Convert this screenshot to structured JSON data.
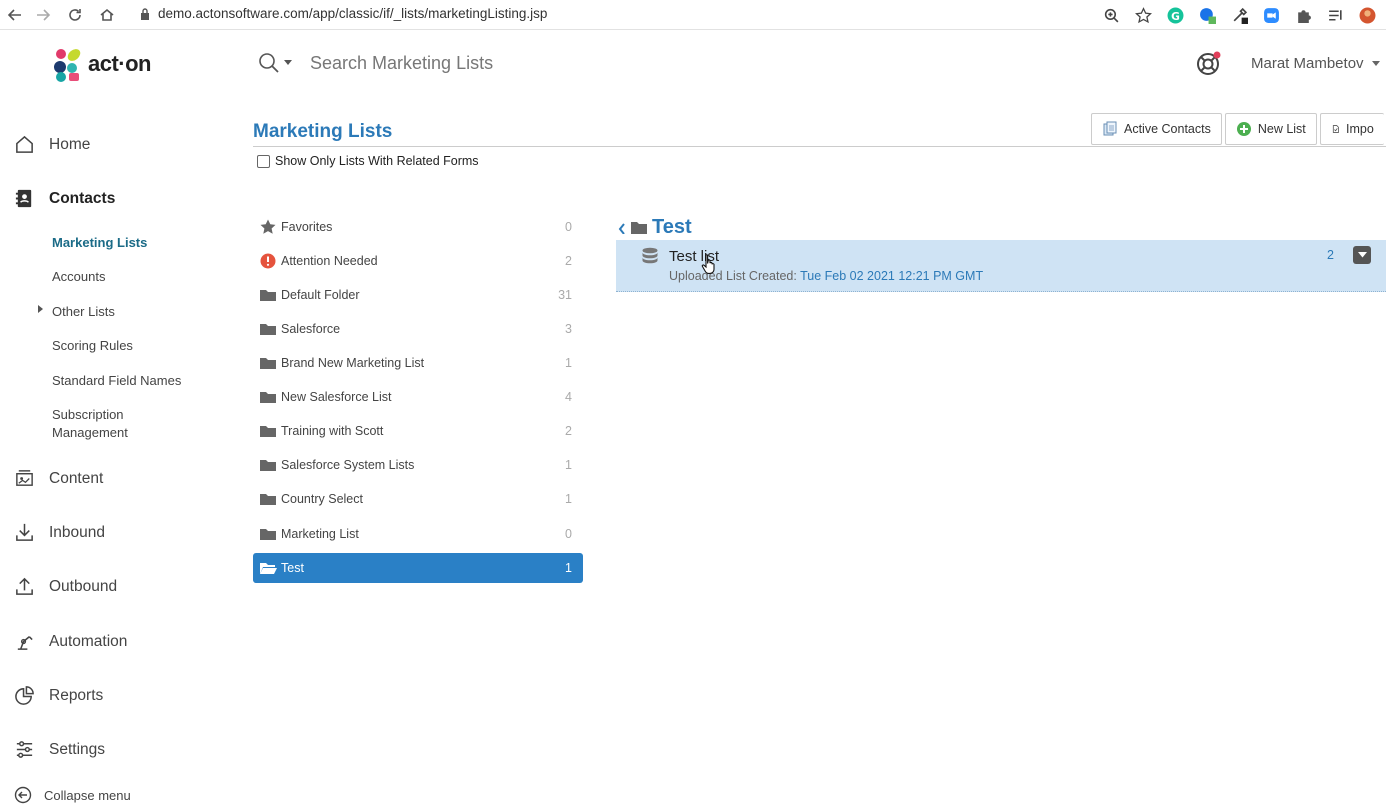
{
  "browser": {
    "url": "demo.actonsoftware.com/app/classic/if/_lists/marketingListing.jsp"
  },
  "header": {
    "logo_text": "act·on",
    "search_placeholder": "Search Marketing Lists",
    "user_name": "Marat Mambetov"
  },
  "sidebar": {
    "items": [
      {
        "label": "Home"
      },
      {
        "label": "Contacts"
      },
      {
        "label": "Content"
      },
      {
        "label": "Inbound"
      },
      {
        "label": "Outbound"
      },
      {
        "label": "Automation"
      },
      {
        "label": "Reports"
      },
      {
        "label": "Settings"
      }
    ],
    "contacts_sub": [
      {
        "label": "Marketing Lists"
      },
      {
        "label": "Accounts"
      },
      {
        "label": "Other Lists"
      },
      {
        "label": "Scoring Rules"
      },
      {
        "label": "Standard Field Names"
      },
      {
        "label": "Subscription Management"
      }
    ],
    "collapse_label": "Collapse menu"
  },
  "main": {
    "title": "Marketing Lists",
    "toolbar": {
      "active_contacts": "Active Contacts",
      "new_list": "New List",
      "import": "Impo"
    },
    "checkbox_label": "Show Only Lists With Related Forms",
    "folders": [
      {
        "name": "Favorites",
        "count": "0"
      },
      {
        "name": "Attention Needed",
        "count": "2"
      },
      {
        "name": "Default Folder",
        "count": "31"
      },
      {
        "name": "Salesforce",
        "count": "3"
      },
      {
        "name": "Brand New Marketing List",
        "count": "1"
      },
      {
        "name": "New Salesforce List",
        "count": "4"
      },
      {
        "name": "Training with Scott",
        "count": "2"
      },
      {
        "name": "Salesforce System Lists",
        "count": "1"
      },
      {
        "name": "Country Select",
        "count": "1"
      },
      {
        "name": "Marketing List",
        "count": "0"
      },
      {
        "name": "Test",
        "count": "1"
      }
    ],
    "folder_title": "Test",
    "list": {
      "name": "Test list",
      "subtitle": "Uploaded List Created:",
      "date": "Tue Feb 02 2021 12:21 PM GMT",
      "count": "2"
    }
  },
  "colors": {
    "accent": "#2c7ab8",
    "active_folder": "#2a80c6",
    "row_highlight": "#cfe3f4"
  }
}
